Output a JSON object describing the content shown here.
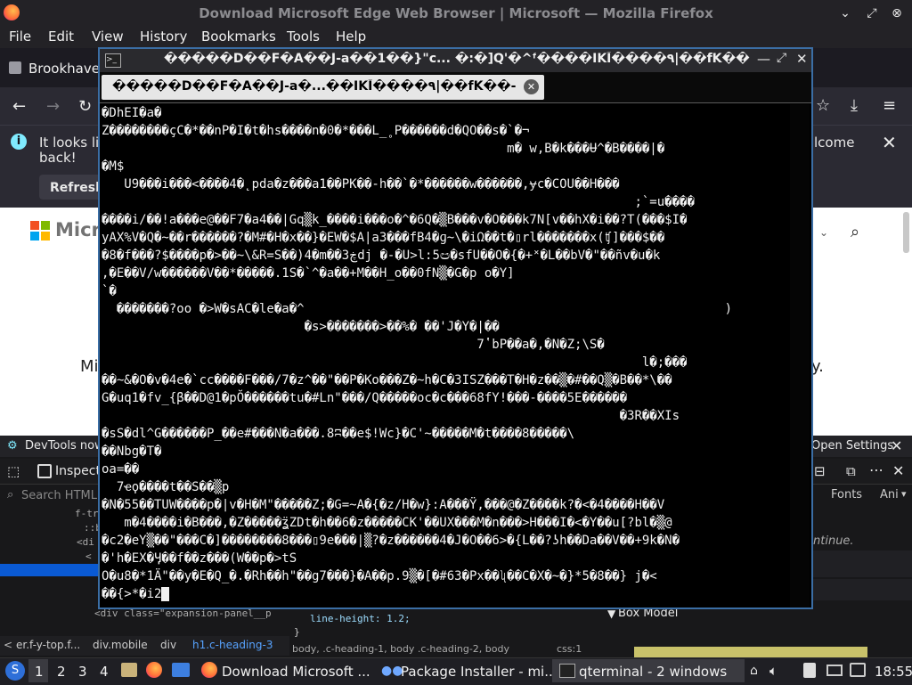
{
  "firefox": {
    "title": "Download Microsoft Edge Web Browser | Microsoft — Mozilla Firefox",
    "menu": [
      "File",
      "Edit",
      "View",
      "History",
      "Bookmarks",
      "Tools",
      "Help"
    ],
    "tab_label": "Brookhaven",
    "notification_text_1": "It looks lik",
    "notification_text_2": "back!",
    "notification_right": "lcome",
    "refresh_label": "Refresh",
    "page_brand": "Micro",
    "page_text_left": "Mi",
    "page_text_right": "y.",
    "devtools_banner": "DevTools now f",
    "devtools_open_settings": "Open Settings",
    "inspector_label": "Inspecto",
    "search_html_placeholder": "Search HTML",
    "fonts_tab": "Fonts",
    "anim_tab": "Ani",
    "continue_text": "ntinue.",
    "box_model": "Box Model",
    "css_line_height": "line-height: 1.2;",
    "css_brace": "}",
    "expansion_line": "<div class=\"expansion-panel__p",
    "breadcrumb": [
      "er.f-y-top.f...",
      "div.mobile",
      "div",
      "h1.c-heading-3"
    ],
    "css_footer": "body, .c-heading-1, body .c-heading-2, body",
    "css_footer_right": "css:1",
    "tree_lines": [
      "f-tr",
      "::b",
      "<di",
      "<"
    ]
  },
  "terminal": {
    "title": "�����D��F�A��J-a��1��}\"c... �:�]Q'�^ᶠ����IKĪ����٩|��fK��",
    "tab_label": "�����D��F�A��J-a�...��IKĪ����٩|��fK��-",
    "lines": [
      "�DhEI�a�",
      "Z��������çC�*��nP�I�t�hs����n�0�*���L_˳P������d�QO��s�`�¬",
      "                                                      m� w,B�k���Ʉ^�B����|�",
      "�M$",
      "   U9���i���<����4�˛pda�z���a1��PK��-h��`�*������w������,ɏc�COU��H���",
      "                                                                       ;`=u����",
      "����i/��!a���e@��F7�a4��|Gq▒k_����i���o�^�6Q�▒B���v�O���k7N[v��hX�i��?T(���$I�",
      "yAX%V�Q�~��r������?�M#�H�x��}�EW�$A|a3���fB4�ɡ~\\�iΩ��t�▯rl�������x(ʧ]���$��",
      "�8�f���?$����p�>��~\\&R=S��)4�m��3ڿdj �-�U>l:5ඏ�sfU��O�{�+˟�L��bV�\"��ñv�u�k",
      ",�E��V/w������V��*�����.1S�`^�a��+M��H_o��0fN▒�G�p o�Y]",
      "`�",
      "  �������?oo �>W�sAC�le�a�^                                                        )",
      "                           �s>�������>��%� ��'J�Y�|��",
      "                                                  7ʽbP��a�,�N�Z;\\S�",
      "                                                                        l�;���",
      "��~&�O�v�4e�`cc����F���/7�z^��\"��P�Ko���Z�~h�C�3ISZ���T�H�z��▒�#��Q▒�B��*\\��",
      "G�uq1�fv_{β��D@1�pŎ������tu�#Ln\"���/Q�����oc�c���68fY!���-����5E������",
      "                                                                     �3R��XIs",
      "�sS�dl^G������P_��e#���N�a���.8ʭ��e$!Wc}�C'~�����M�t����8�����\\",
      "��Nbg�T�",
      "oa=��",
      "  7ҽϙ����t��S��▒p",
      "�N�55��TUW����p�|v�H�M\"�����Z;�G=~A�{�z/H�w}:A���Ÿ,���@�Z����k?�<�4����H��V",
      "   m�4����i�B���,�Z�����ʓ̈ZDt�h��6�z�����CK'��UX���M�n���>H���I�<�Y��u[?bl�▒@",
      "�c2�eY▒��\"���C�]��������8���▯9e���|▒?�z������4�J�O��6>�{L��?ʖh��Da��V��+9k�N�",
      "�'h�EX�Ӌ��f��z���(W��p�>tS",
      "O�u8�*1Ӓ\"��y�E�Q_�.�Rh��h\"��g7���}�A��p.9▒�[�#63�Px��ʯ��C�X�~�}*5�8��} j�<",
      "��{>*�i2"
    ]
  },
  "taskbar": {
    "workspaces": [
      "1",
      "2",
      "3",
      "4"
    ],
    "items": [
      "Download Microsoft ...",
      "Package Installer - mi...",
      "qterminal - 2 windows"
    ],
    "clock": "18:55"
  }
}
